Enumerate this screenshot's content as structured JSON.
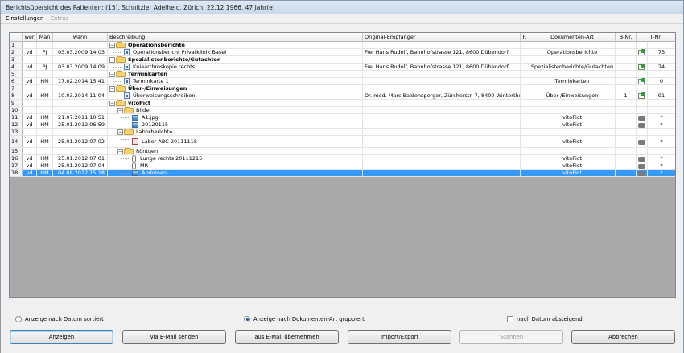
{
  "window": {
    "title": "Berichtsübersicht des Patienten: (15), Schnitzler Adelheid, Zürich, 22.12.1966, 47 Jahr(e)"
  },
  "menu": {
    "item1": "Einstellungen",
    "item2": "Extras"
  },
  "columns": {
    "num": "",
    "wer": "wer",
    "man": "Man",
    "wann": "wann",
    "desc": "Beschreibung",
    "empfaenger": "Original-Empfänger",
    "f": "F.",
    "art": "Dokumenten-Art",
    "bnr": "B-Nr.",
    "tnr": "T-Nr."
  },
  "rows": [
    {
      "num": "1",
      "wer": "",
      "man": "",
      "wann": "",
      "desc": "Operationsberichte",
      "emp": "",
      "art": "",
      "bnr": "",
      "tnr": ""
    },
    {
      "num": "2",
      "wer": "vd",
      "man": "PJ",
      "wann": "03.03.2009 14:03",
      "desc": "Operationsbericht Privatklinik Basel",
      "emp": "Frei Hans Rudolf, Bahnhofstrasse 121, 8600 Dübendorf",
      "art": "Operationsberichte",
      "bnr": "",
      "tnr": "73"
    },
    {
      "num": "3",
      "wer": "",
      "man": "",
      "wann": "",
      "desc": "Spezialistenberichte/Gutachten",
      "emp": "",
      "art": "",
      "bnr": "",
      "tnr": ""
    },
    {
      "num": "4",
      "wer": "vd",
      "man": "PJ",
      "wann": "03.03.2009 14:09",
      "desc": "Kniearthroskopie rechts",
      "emp": "Frei Hans Rudolf, Bahnhofstrasse 121, 8600 Dübendorf",
      "art": "Spezialistenberichte/Gutachten",
      "bnr": "",
      "tnr": "74"
    },
    {
      "num": "5",
      "wer": "",
      "man": "",
      "wann": "",
      "desc": "Terminkarten",
      "emp": "",
      "art": "",
      "bnr": "",
      "tnr": ""
    },
    {
      "num": "6",
      "wer": "vd",
      "man": "HM",
      "wann": "17.02.2014 15:41",
      "desc": "Terminkarte 1",
      "emp": "",
      "art": "Terminkarten",
      "bnr": "",
      "tnr": "0"
    },
    {
      "num": "7",
      "wer": "",
      "man": "",
      "wann": "",
      "desc": "Über-/Einweisungen",
      "emp": "",
      "art": "",
      "bnr": "",
      "tnr": ""
    },
    {
      "num": "8",
      "wer": "vd",
      "man": "HM",
      "wann": "10.03.2014 11:04",
      "desc": "Überweisungsschreiben",
      "emp": "Dr. med. Marc Baldensperger, Zürcherstr. 7, 8400 Winterthur",
      "art": "Über-/Einweisungen",
      "bnr": "1",
      "tnr": "91"
    },
    {
      "num": "9",
      "wer": "",
      "man": "",
      "wann": "",
      "desc": "vitoPict",
      "emp": "",
      "art": "",
      "bnr": "",
      "tnr": ""
    },
    {
      "num": "10",
      "wer": "",
      "man": "",
      "wann": "",
      "desc": "Bilder",
      "emp": "",
      "art": "",
      "bnr": "",
      "tnr": ""
    },
    {
      "num": "11",
      "wer": "vd",
      "man": "HM",
      "wann": "21.07.2011 10:51",
      "desc": "A1.jpg",
      "emp": "",
      "art": "vitoPict",
      "bnr": "",
      "tnr": "*"
    },
    {
      "num": "12",
      "wer": "vd",
      "man": "HM",
      "wann": "25.01.2012 06:59",
      "desc": "20120115",
      "emp": "",
      "art": "vitoPict",
      "bnr": "",
      "tnr": "*"
    },
    {
      "num": "13",
      "wer": "",
      "man": "",
      "wann": "",
      "desc": "Laborberichte",
      "emp": "",
      "art": "",
      "bnr": "",
      "tnr": ""
    },
    {
      "num": "14",
      "wer": "vd",
      "man": "HM",
      "wann": "25.01.2012 07:02",
      "desc": "Labor ABC 20111118",
      "emp": "",
      "art": "vitoPict",
      "bnr": "",
      "tnr": "*"
    },
    {
      "num": "15",
      "wer": "",
      "man": "",
      "wann": "",
      "desc": "Röntgen",
      "emp": "",
      "art": "",
      "bnr": "",
      "tnr": ""
    },
    {
      "num": "16",
      "wer": "vd",
      "man": "HM",
      "wann": "25.01.2012 07:01",
      "desc": "Lunge rechts 20111215",
      "emp": "",
      "art": "vitoPict",
      "bnr": "",
      "tnr": "*"
    },
    {
      "num": "17",
      "wer": "vd",
      "man": "HM",
      "wann": "25.01.2012 07:04",
      "desc": "MR",
      "emp": "",
      "art": "vitoPict",
      "bnr": "",
      "tnr": "*"
    },
    {
      "num": "18",
      "wer": "vd",
      "man": "HM",
      "wann": "04.06.2012 15:18",
      "desc": "Abdomen",
      "emp": "",
      "art": "vitoPict",
      "bnr": "",
      "tnr": "*"
    }
  ],
  "options": {
    "sort_date": "Anzeige nach Datum sortiert",
    "group_type": "Anzeige nach Dokumenten-Art gruppiert",
    "date_desc": "nach Datum absteigend"
  },
  "buttons": {
    "anzeigen": "Anzeigen",
    "email_send": "via E-Mail senden",
    "email_take": "aus E-Mail übernehmen",
    "import_export": "Import/Export",
    "scan": "Scannen",
    "cancel": "Abbrechen"
  },
  "colors": {
    "selection": "#3399ff",
    "grid_bg": "#a9a9a9",
    "folder": "#f4d271"
  }
}
